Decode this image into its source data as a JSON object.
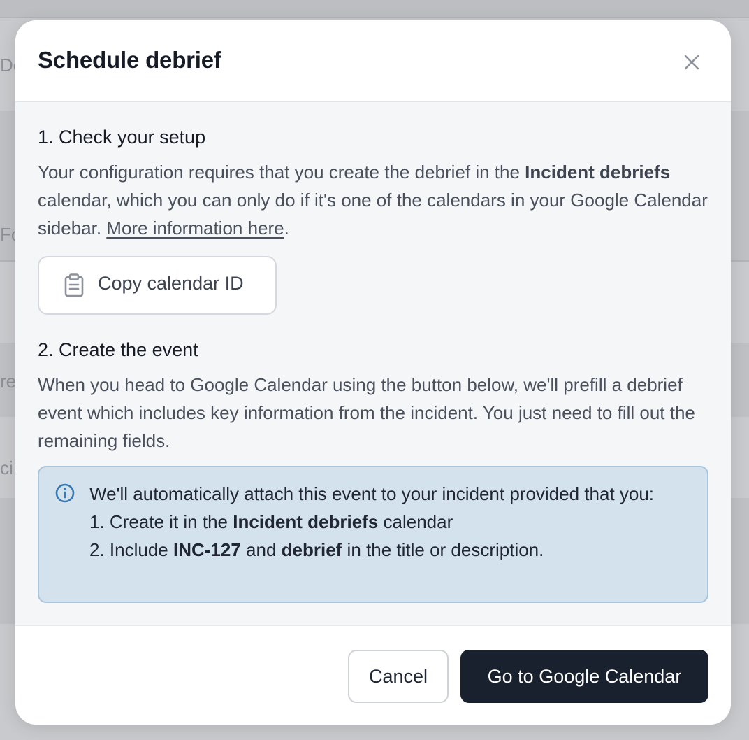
{
  "background": {
    "fragments": [
      "De",
      "Fo",
      "re",
      "ci"
    ]
  },
  "modal": {
    "title": "Schedule debrief",
    "close_icon": "close-icon",
    "step1": {
      "heading": "1. Check your setup",
      "text_before": "Your configuration requires that you create the debrief in the ",
      "calendar_name": "Incident debriefs",
      "text_after": " calendar, which you can only do if it's one of the calendars in your Google Calendar sidebar. ",
      "link_text": "More information here",
      "link_suffix": ".",
      "copy_button_label": "Copy calendar ID",
      "copy_icon": "clipboard-icon"
    },
    "step2": {
      "heading": "2. Create the event",
      "text": "When you head to Google Calendar using the button below, we'll prefill a debrief event which includes key information from the incident. You just need to fill out the remaining fields."
    },
    "info": {
      "icon": "info-icon",
      "intro": "We'll automatically attach this event to your incident provided that you:",
      "item1_prefix": "1. Create it in the ",
      "item1_bold": "Incident debriefs",
      "item1_suffix": " calendar",
      "item2_prefix": "2. Include ",
      "item2_bold1": "INC-127",
      "item2_mid": " and ",
      "item2_bold2": "debrief",
      "item2_suffix": " in the title or description."
    },
    "footer": {
      "cancel_label": "Cancel",
      "primary_label": "Go to Google Calendar"
    }
  },
  "colors": {
    "primary_button": "#1a212e",
    "info_background": "#d4e2ed",
    "info_border": "#a8c5dc",
    "info_icon": "#3a78b3"
  }
}
